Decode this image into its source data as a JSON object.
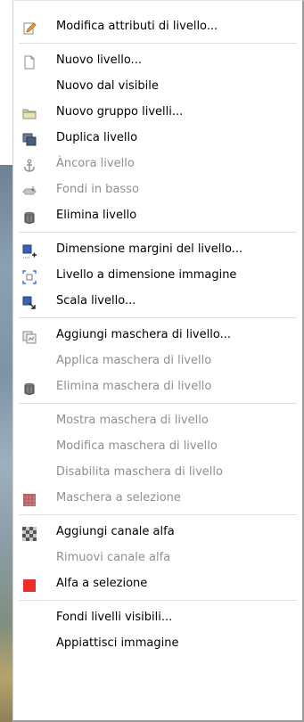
{
  "menu": {
    "items": [
      {
        "label": "Modifica attributi di livello...",
        "icon": "edit-attributes-icon",
        "disabled": false
      },
      {
        "separator": true
      },
      {
        "label": "Nuovo livello...",
        "icon": "new-layer-icon",
        "disabled": false
      },
      {
        "label": "Nuovo dal visibile",
        "icon": "",
        "disabled": false
      },
      {
        "label": "Nuovo gruppo livelli...",
        "icon": "folder-icon",
        "disabled": false
      },
      {
        "label": "Duplica livello",
        "icon": "duplicate-layer-icon",
        "disabled": false
      },
      {
        "label": "Àncora livello",
        "icon": "anchor-icon",
        "disabled": true
      },
      {
        "label": "Fondi in basso",
        "icon": "merge-down-icon",
        "disabled": true
      },
      {
        "label": "Elimina livello",
        "icon": "trash-icon",
        "disabled": false
      },
      {
        "separator": true
      },
      {
        "label": "Dimensione margini del livello...",
        "icon": "layer-boundary-icon",
        "disabled": false
      },
      {
        "label": "Livello a dimensione immagine",
        "icon": "layer-to-image-size-icon",
        "disabled": false
      },
      {
        "label": "Scala livello...",
        "icon": "scale-layer-icon",
        "disabled": false
      },
      {
        "separator": true
      },
      {
        "label": "Aggiungi maschera di livello...",
        "icon": "add-mask-icon",
        "disabled": false
      },
      {
        "label": "Applica maschera di livello",
        "icon": "",
        "disabled": true
      },
      {
        "label": "Elimina maschera di livello",
        "icon": "trash-icon",
        "disabled": true
      },
      {
        "separator": true
      },
      {
        "label": "Mostra maschera di livello",
        "icon": "",
        "disabled": true
      },
      {
        "label": "Modifica maschera di livello",
        "icon": "",
        "disabled": true
      },
      {
        "label": "Disabilita maschera di livello",
        "icon": "",
        "disabled": true
      },
      {
        "label": "Maschera a selezione",
        "icon": "mask-to-selection-icon",
        "disabled": true
      },
      {
        "separator": true
      },
      {
        "label": "Aggiungi canale alfa",
        "icon": "checkerboard-icon",
        "disabled": false
      },
      {
        "label": "Rimuovi canale alfa",
        "icon": "",
        "disabled": true
      },
      {
        "label": "Alfa a selezione",
        "icon": "alpha-to-selection-icon",
        "disabled": false
      },
      {
        "separator": true
      },
      {
        "label": "Fondi livelli visibili...",
        "icon": "",
        "disabled": false
      },
      {
        "label": "Appiattisci immagine",
        "icon": "",
        "disabled": false
      }
    ]
  }
}
